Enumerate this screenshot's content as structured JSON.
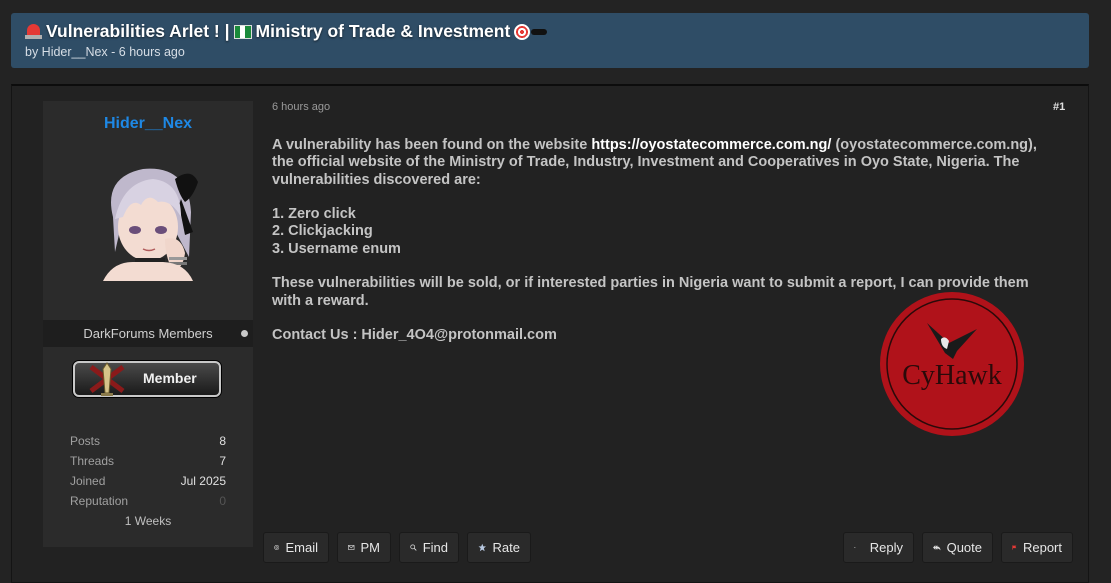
{
  "thread": {
    "title": "Vulnerabilities Arlet ! | ",
    "title_suffix": " Ministry of Trade & Investment ",
    "meta": "by Hider__Nex - 6 hours ago"
  },
  "author": {
    "name": "Hider__Nex",
    "usergroup": "DarkForums Members",
    "rank": "Member",
    "stats": [
      {
        "label": "Posts",
        "value": "8"
      },
      {
        "label": "Threads",
        "value": "7"
      },
      {
        "label": "Joined",
        "value": "Jul 2025"
      },
      {
        "label": "Reputation",
        "value": "0"
      }
    ],
    "extra": "1 Weeks"
  },
  "post": {
    "date": "6 hours ago",
    "number": "#1",
    "intro": "A vulnerability has been found on the website ",
    "link": "https://oyostatecommerce.com.ng/",
    "intro_rest": " (oyostatecommerce.com.ng), the official website of the Ministry of Trade, Industry, Investment and Cooperatives in Oyo State, Nigeria. The vulnerabilities discovered are:",
    "list": [
      "1. Zero click",
      "2. Clickjacking",
      "3. Username enum"
    ],
    "closing": "These vulnerabilities will be sold, or if interested parties in Nigeria want to submit a report, I can provide them with a reward.",
    "contact": "Contact Us : Hider_4O4@protonmail.com",
    "logo_text": "CyHawk"
  },
  "buttons": {
    "email": "Email",
    "pm": "PM",
    "find": "Find",
    "rate": "Rate",
    "reply": "Reply",
    "quote": "Quote",
    "report": "Report"
  },
  "colors": {
    "header_bg": "#2f4d66",
    "username": "#1e88e5",
    "logo_red": "#b0121a",
    "report_flag": "#e53935"
  }
}
